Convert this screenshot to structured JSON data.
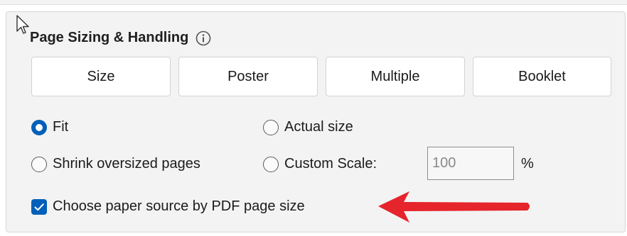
{
  "section": {
    "title": "Page Sizing & Handling",
    "info_icon": "info-icon"
  },
  "tabs": [
    {
      "label": "Size",
      "selected": true
    },
    {
      "label": "Poster"
    },
    {
      "label": "Multiple"
    },
    {
      "label": "Booklet"
    }
  ],
  "scaling": {
    "fit_label": "Fit",
    "fit_checked": true,
    "actual_size_label": "Actual size",
    "shrink_label": "Shrink oversized pages",
    "custom_scale_label": "Custom Scale:",
    "custom_scale_value": "100",
    "percent_label": "%"
  },
  "paper_source": {
    "label": "Choose paper source by PDF page size",
    "checked": true
  },
  "colors": {
    "accent": "#005fb8",
    "annotation_arrow": "#e5242b",
    "panel_bg": "#f3f3f3"
  }
}
